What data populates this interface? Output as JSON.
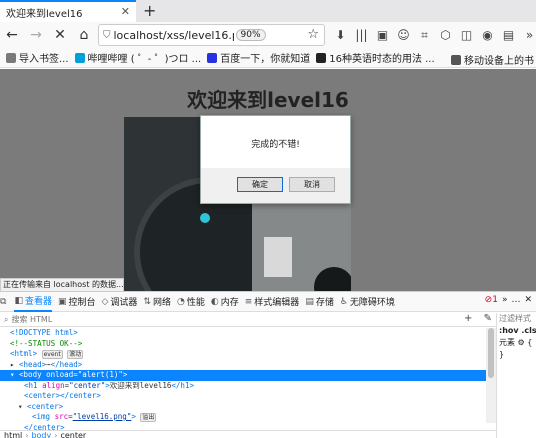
{
  "tab": {
    "title": "欢迎来到level16",
    "close": "✕",
    "new_tab": "+"
  },
  "nav": {
    "back": "←",
    "forward": "→",
    "stop": "✕",
    "home": "⌂",
    "url": "localhost/xss/level16.php",
    "zoom": "90%",
    "bookmark_star": "☆",
    "tools": [
      "⬇",
      "|||",
      "▣",
      "☺",
      "⌗",
      "⬡",
      "◫",
      "◉",
      "▤",
      "»"
    ]
  },
  "bookmarks": {
    "items": [
      {
        "label": "导入书签...",
        "color": "#7a7a7a"
      },
      {
        "label": "哔哩哔哩 ( ゜- ゜)つロ ...",
        "color": "#00a1d6"
      },
      {
        "label": "百度一下，你就知道",
        "color": "#2932e1"
      },
      {
        "label": "16种英语时态的用法 ...",
        "color": "#222222"
      }
    ],
    "right": {
      "label": "移动设备上的书",
      "color": "#555555"
    }
  },
  "page": {
    "heading": "欢迎来到level16",
    "alert": {
      "message": "完成的不错!",
      "ok": "确定",
      "cancel": "取消"
    },
    "status": "正在传输来自 localhost 的数据..."
  },
  "devtools": {
    "tabs": [
      {
        "icon": "⧉",
        "label": ""
      },
      {
        "icon": "◧",
        "label": "查看器",
        "active": true
      },
      {
        "icon": "▣",
        "label": "控制台"
      },
      {
        "icon": "◇",
        "label": "调试器"
      },
      {
        "icon": "⇅",
        "label": "网络"
      },
      {
        "icon": "◔",
        "label": "性能"
      },
      {
        "icon": "◐",
        "label": "内存"
      },
      {
        "icon": "≡",
        "label": "样式编辑器"
      },
      {
        "icon": "▤",
        "label": "存储"
      },
      {
        "icon": "♿",
        "label": "无障碍环境"
      }
    ],
    "errors": "1",
    "more": "»",
    "menu": "…",
    "close": "✕",
    "search_placeholder": "搜索 HTML",
    "add": "+",
    "picker": "✎",
    "side": {
      "filter": "过滤样式",
      "hov": ":hov .cls",
      "element": "元素 ⚙ {",
      "brace": "}"
    },
    "crumbs": [
      "html",
      "body",
      "center"
    ],
    "colors": {
      "accent": "#0a84ff",
      "tag": "#0074e8",
      "attr": "#dd00a9",
      "comment": "#058b00"
    }
  }
}
